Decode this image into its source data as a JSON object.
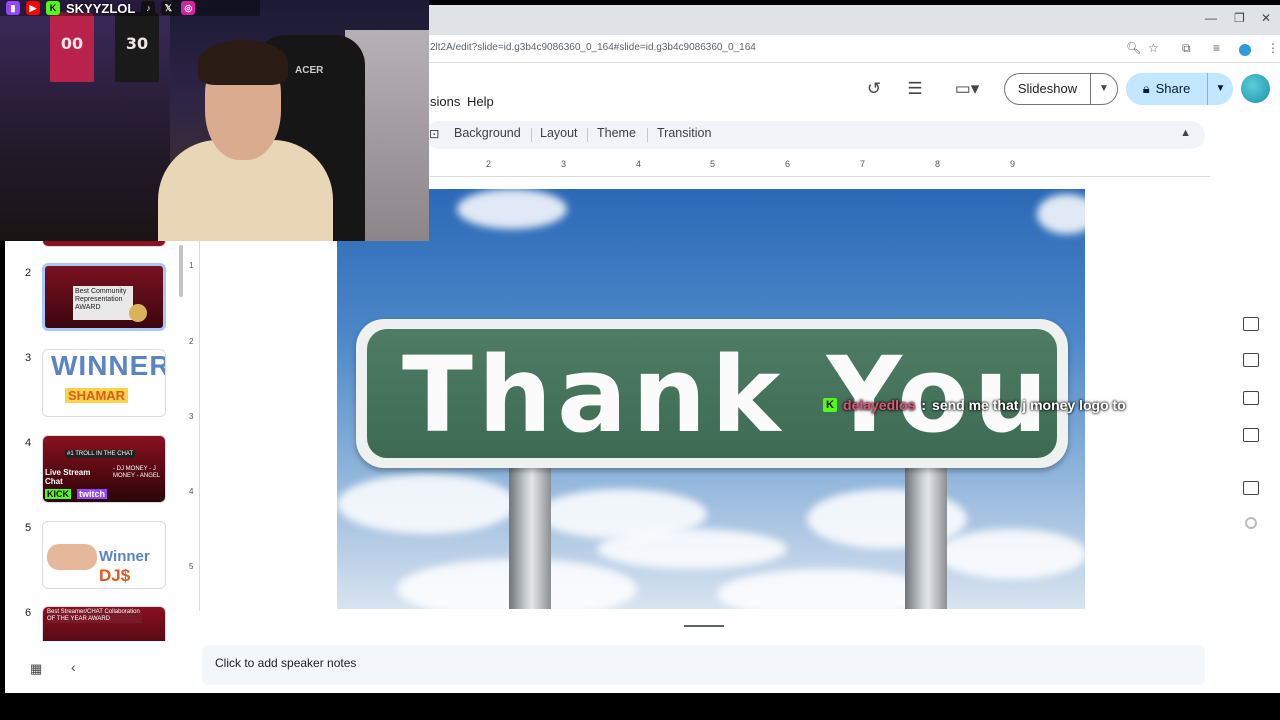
{
  "browser": {
    "url": "2lt2A/edit?slide=id.g3b4c9086360_0_164#slide=id.g3b4c9086360_0_164"
  },
  "menu": {
    "extensions_partial": "sions",
    "help": "Help"
  },
  "header": {
    "slideshow_label": "Slideshow",
    "share_label": "Share"
  },
  "toolbar": {
    "background": "Background",
    "layout": "Layout",
    "theme": "Theme",
    "transition": "Transition"
  },
  "ruler": {
    "h_ticks": [
      "2",
      "3",
      "4",
      "5",
      "6",
      "7",
      "8",
      "9"
    ],
    "v_ticks": [
      "1",
      "2",
      "3",
      "4",
      "5"
    ]
  },
  "filmstrip": {
    "slides": [
      {
        "number": "2",
        "text": "Best Community Representation AWARD"
      },
      {
        "number": "3",
        "text": "WINNER",
        "subtext": "SHAMAR"
      },
      {
        "number": "4",
        "text": "#1 TROLL IN THE CHAT",
        "subtext": "Live Stream Chat",
        "names": "- DJ MONEY - J MONEY - ANGEL",
        "kick": "KICK",
        "twitch": "twitch"
      },
      {
        "number": "5",
        "text": "Winner",
        "subtext": "DJ$"
      },
      {
        "number": "6",
        "text": "Best Streamer/CHAT Collaboration OF THE YEAR AWARD"
      }
    ]
  },
  "slide": {
    "sign_text": "Thank You"
  },
  "chat_overlay": {
    "badge": "K",
    "username": "delayedlos",
    "separator": ":",
    "message": "send me that j money logo to"
  },
  "notes": {
    "placeholder": "Click to add speaker notes"
  },
  "webcam": {
    "handle": "SKYYZLOL",
    "jersey_numbers": [
      "00",
      "30"
    ],
    "chair_brand": "ACER"
  },
  "colors": {
    "share_bg": "#c2e7ff",
    "sign_green": "#3d6a52",
    "kick_green": "#53fc18",
    "chat_user": "#e2567a"
  }
}
